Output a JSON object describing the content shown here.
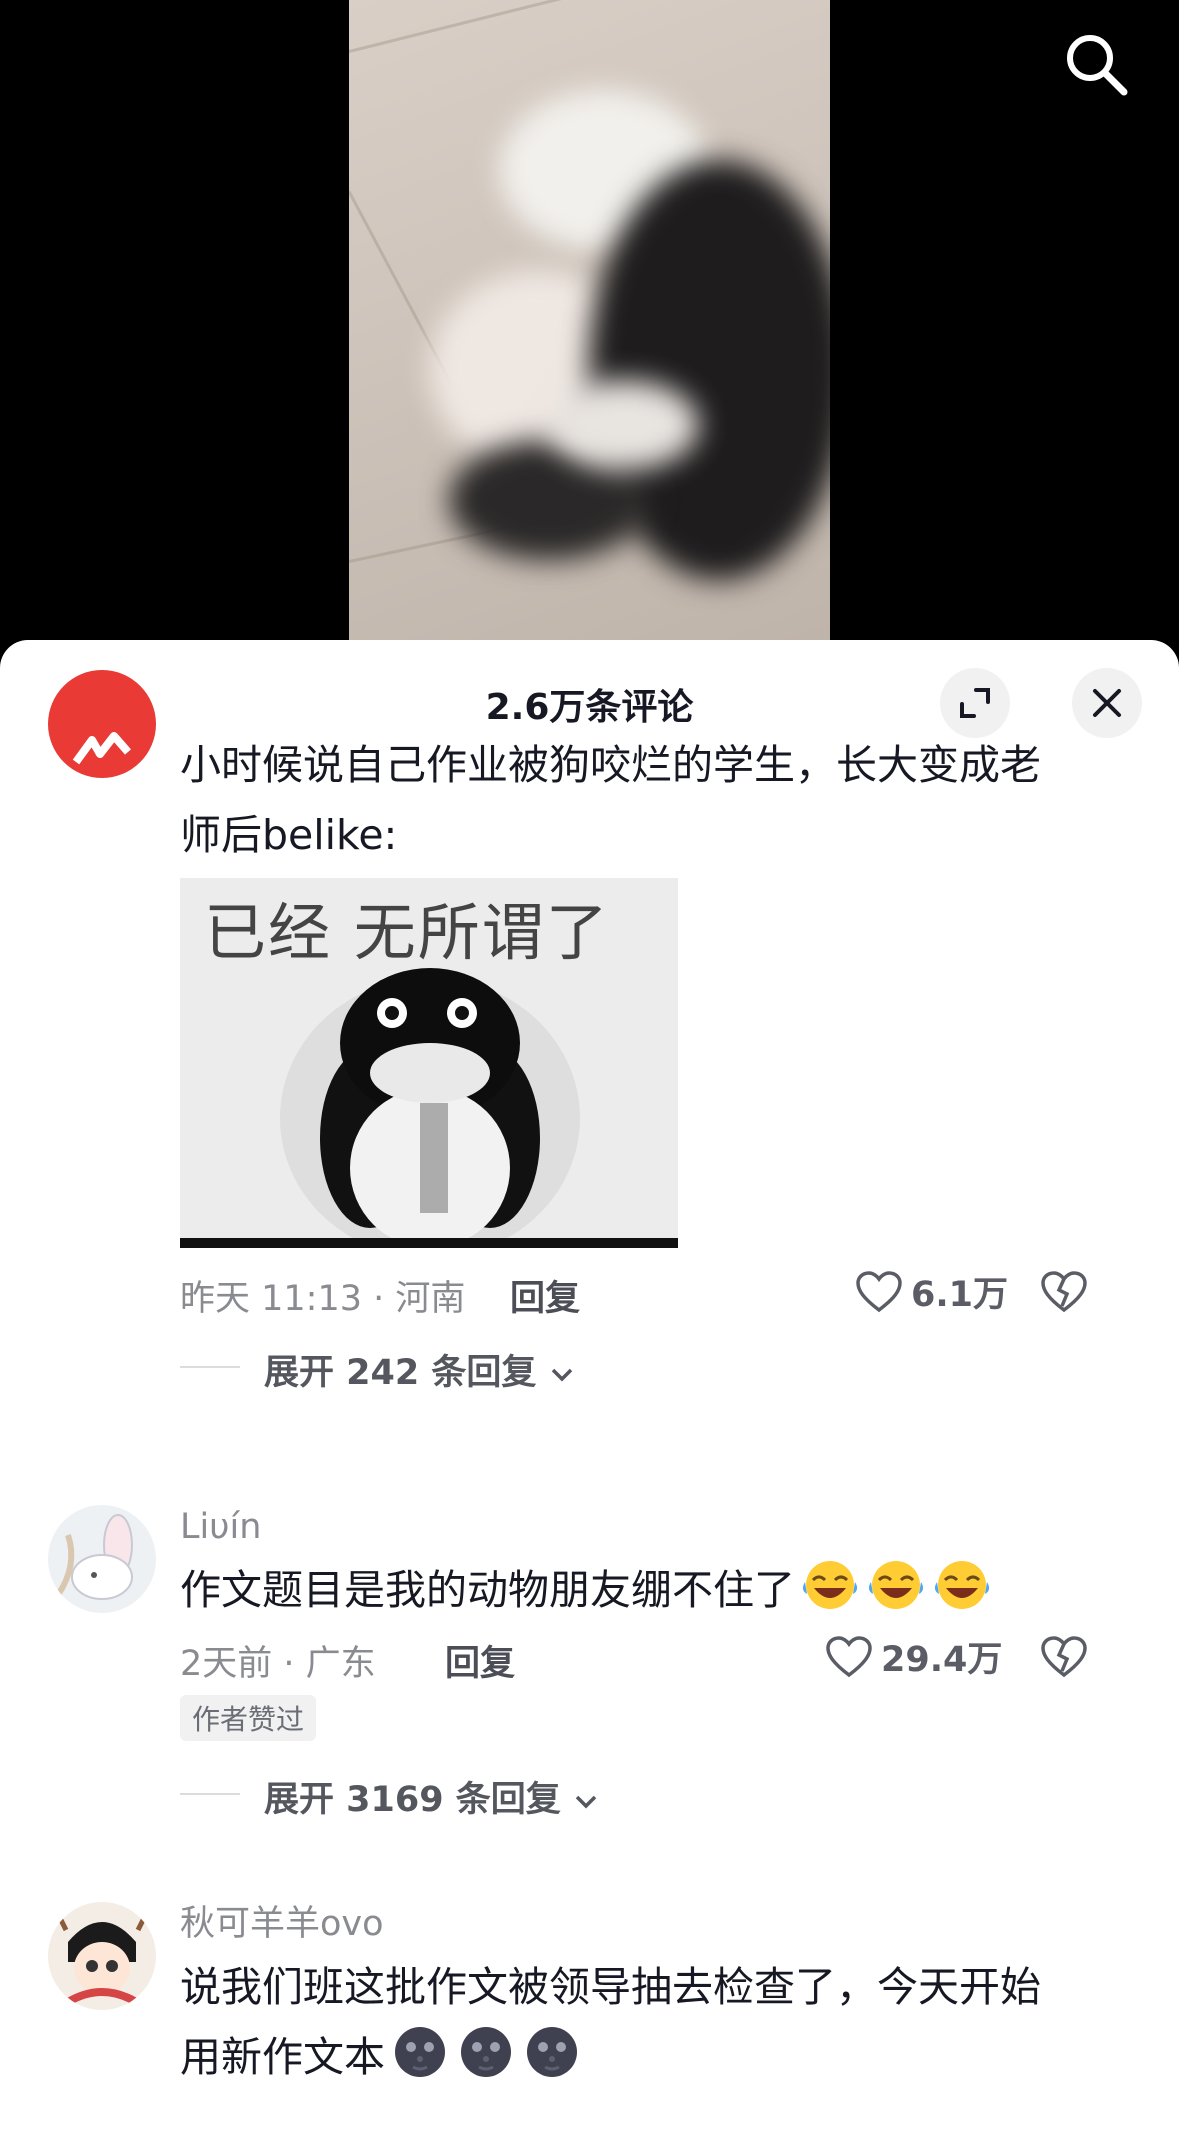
{
  "header": {
    "comment_count_title": "2.6万条评论"
  },
  "comments": [
    {
      "text_line1": "小时候说自己作业被狗咬烂的学生，长大变成老",
      "text_line2": "师后belike:",
      "image_caption": "已经 无所谓了",
      "time_location": "昨天 11:13 · 河南",
      "reply_label": "回复",
      "like_count": "6.1万",
      "expand_label": "展开 242 条回复"
    },
    {
      "username": "Liυín",
      "text": "作文题目是我的动物朋友绷不住了",
      "emoji_count": 3,
      "time_location": "2天前 · 广东",
      "reply_label": "回复",
      "like_count": "29.4万",
      "badge": "作者赞过",
      "expand_label": "展开 3169 条回复"
    },
    {
      "username": "秋可羊羊ovo",
      "text_line1": "说我们班这批作文被领导抽去检查了，今天开始",
      "text_line2": "用新作文本",
      "emoji_count": 3
    }
  ],
  "icons": {
    "search": "search-icon",
    "expand": "expand-icon",
    "close": "close-icon",
    "like": "heart-icon",
    "dislike": "broken-heart-icon",
    "chevron": "chevron-down-icon"
  },
  "colors": {
    "sheet_bg": "#ffffff",
    "text_primary": "#161823",
    "text_secondary": "#8a8b91",
    "video_bg": "#000000"
  }
}
